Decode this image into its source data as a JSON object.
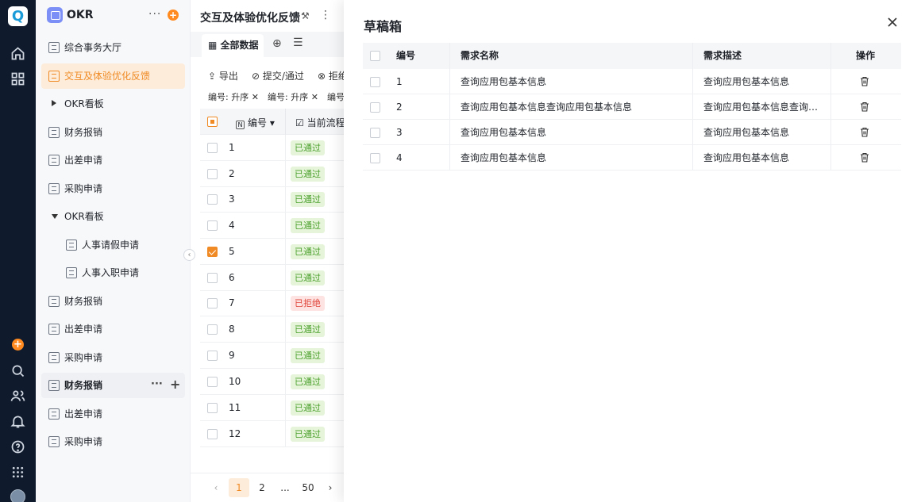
{
  "rail": {
    "logo": "Q",
    "icons": [
      "home-icon",
      "apps-grid-icon",
      "add-circle-icon",
      "search-icon",
      "users-icon",
      "bell-icon",
      "help-icon",
      "more-apps-icon"
    ]
  },
  "sidebar": {
    "app_title": "OKR",
    "more": "···",
    "add": "+",
    "items": [
      {
        "label": "综合事务大厅"
      },
      {
        "label": "交互及体验优化反馈"
      },
      {
        "label": "OKR看板"
      },
      {
        "label": "财务报销"
      },
      {
        "label": "出差申请"
      },
      {
        "label": "采购申请"
      },
      {
        "label": "OKR看板"
      },
      {
        "label": "人事请假申请"
      },
      {
        "label": "人事入职申请"
      },
      {
        "label": "财务报销"
      },
      {
        "label": "出差申请"
      },
      {
        "label": "采购申请"
      },
      {
        "label": "财务报销"
      },
      {
        "label": "出差申请"
      },
      {
        "label": "采购申请"
      }
    ]
  },
  "main": {
    "title": "交互及体验优化反馈",
    "tab_label": "全部数据",
    "toolbar": {
      "export": "导出",
      "submit": "提交/通过",
      "reject": "拒绝"
    },
    "filters": [
      "编号: 升序",
      "编号: 升序",
      "编号"
    ],
    "columns": {
      "id": "编号",
      "flow": "当前流程"
    },
    "rows": [
      {
        "id": "1",
        "status": "已通过"
      },
      {
        "id": "2",
        "status": "已通过"
      },
      {
        "id": "3",
        "status": "已通过"
      },
      {
        "id": "4",
        "status": "已通过"
      },
      {
        "id": "5",
        "status": "已通过"
      },
      {
        "id": "6",
        "status": "已通过"
      },
      {
        "id": "7",
        "status": "已拒绝"
      },
      {
        "id": "8",
        "status": "已通过"
      },
      {
        "id": "9",
        "status": "已通过"
      },
      {
        "id": "10",
        "status": "已通过"
      },
      {
        "id": "11",
        "status": "已通过"
      },
      {
        "id": "12",
        "status": "已通过"
      }
    ],
    "pager": {
      "prev": "‹",
      "p1": "1",
      "p2": "2",
      "ellipsis": "...",
      "last": "50",
      "next": "›"
    }
  },
  "drafts": {
    "title": "草稿箱",
    "headers": {
      "id": "编号",
      "name": "需求名称",
      "desc": "需求描述",
      "action": "操作"
    },
    "rows": [
      {
        "id": "1",
        "name": "查询应用包基本信息",
        "desc": "查询应用包基本信息"
      },
      {
        "id": "2",
        "name": "查询应用包基本信息查询应用包基本信息",
        "desc": "查询应用包基本信息查询应用包基本信息"
      },
      {
        "id": "3",
        "name": "查询应用包基本信息",
        "desc": "查询应用包基本信息"
      },
      {
        "id": "4",
        "name": "查询应用包基本信息",
        "desc": "查询应用包基本信息"
      }
    ]
  },
  "colors": {
    "accent": "#f08a24",
    "rail": "#0f1b2d",
    "approved_bg": "#e6f4d9",
    "rejected_bg": "#fde3e1"
  }
}
